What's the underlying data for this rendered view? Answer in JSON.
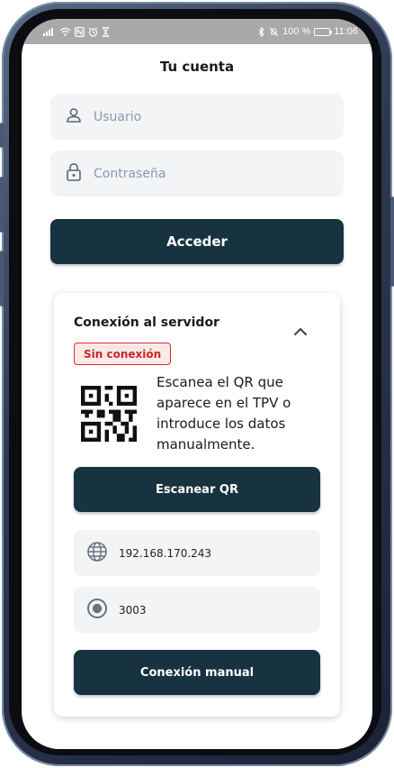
{
  "status_bar": {
    "battery_percent": "100 %",
    "time": "11:06"
  },
  "page": {
    "title": "Tu cuenta"
  },
  "login": {
    "username_placeholder": "Usuario",
    "password_placeholder": "Contraseña",
    "submit_label": "Acceder"
  },
  "server_card": {
    "title": "Conexión al servidor",
    "status_label": "Sin conexión",
    "instructions": "Escanea el QR que aparece en el TPV  o introduce los datos manualmente.",
    "scan_button_label": "Escanear QR",
    "ip_value": "192.168.170.243",
    "port_value": "3003",
    "manual_button_label": "Conexión manual"
  },
  "icons": {
    "user": "user-icon",
    "password": "lock-icon",
    "collapse": "chevron-up-icon",
    "qr": "qr-code-icon",
    "ip": "globe-icon",
    "port": "radio-target-icon"
  },
  "colors": {
    "primary_button": "#173340",
    "status_error": "#c62828",
    "status_error_bg": "#fde8e8",
    "input_bg": "#f3f4f6",
    "placeholder": "#8a97b3"
  }
}
